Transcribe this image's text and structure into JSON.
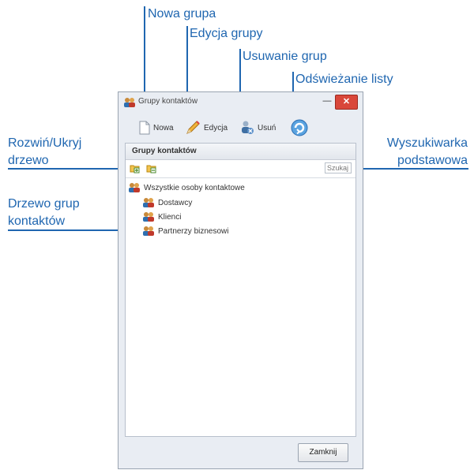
{
  "callouts": {
    "new_group": "Nowa grupa",
    "edit_group": "Edycja grupy",
    "delete_groups": "Usuwanie grup",
    "refresh_list": "Odświeżanie listy",
    "expand_collapse_line1": "Rozwiń/Ukryj",
    "expand_collapse_line2": "drzewo",
    "tree_line1": "Drzewo grup",
    "tree_line2": "kontaktów",
    "search_line1": "Wyszukiwarka",
    "search_line2": "podstawowa"
  },
  "window": {
    "title": "Grupy kontaktów",
    "minimize_glyph": "—",
    "close_glyph": "✕"
  },
  "toolbar": {
    "new_label": "Nowa",
    "edit_label": "Edycja",
    "delete_label": "Usuń"
  },
  "panel": {
    "header": "Grupy kontaktów",
    "search_placeholder": "Szukaj"
  },
  "tree": {
    "root": "Wszystkie osoby kontaktowe",
    "children": [
      "Dostawcy",
      "Klienci",
      "Partnerzy biznesowi"
    ]
  },
  "footer": {
    "close_label": "Zamknij"
  },
  "colors": {
    "accent": "#1f66b0",
    "close_button": "#d9473a"
  },
  "icons": [
    "users-icon",
    "new-document-icon",
    "pencil-icon",
    "delete-users-icon",
    "refresh-icon",
    "expand-tree-icon",
    "collapse-tree-icon"
  ]
}
